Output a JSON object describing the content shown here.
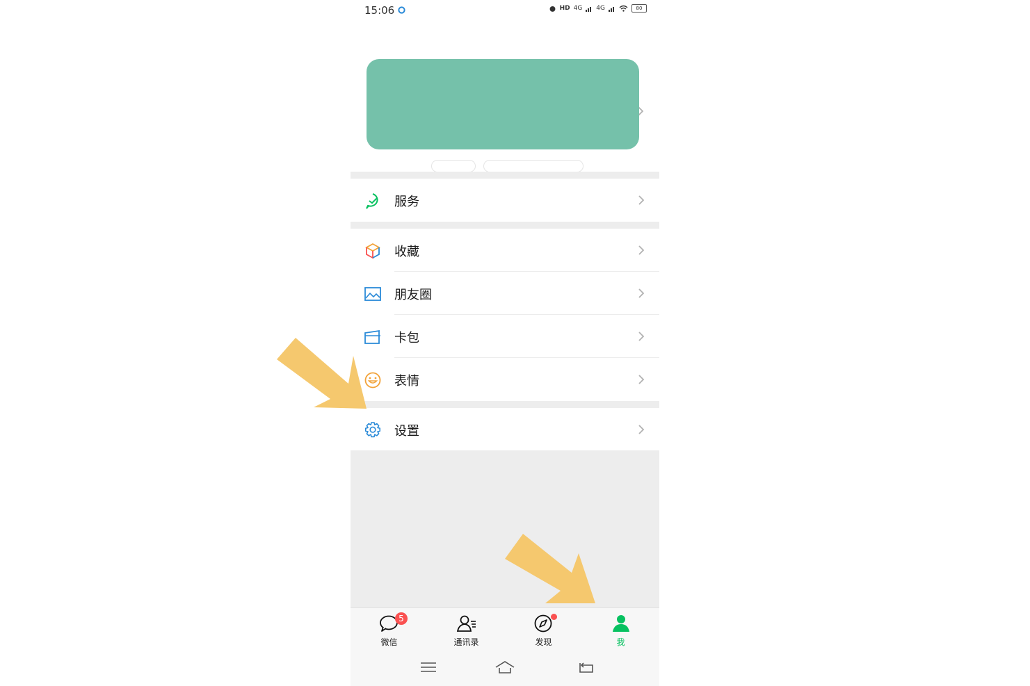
{
  "status_bar": {
    "time": "15:06",
    "hd": "HD",
    "net1": "4G",
    "net2": "4G",
    "battery": "80"
  },
  "menu": {
    "services": "服务",
    "favorites": "收藏",
    "moments": "朋友圈",
    "cards": "卡包",
    "stickers": "表情",
    "settings": "设置"
  },
  "tabbar": {
    "chats": "微信",
    "chats_badge": "5",
    "contacts": "通讯录",
    "discover": "发现",
    "me": "我"
  },
  "colors": {
    "accent": "#07c160",
    "badge": "#fa5151",
    "arrow": "#f5c86e",
    "redaction": "#75c1aa"
  }
}
